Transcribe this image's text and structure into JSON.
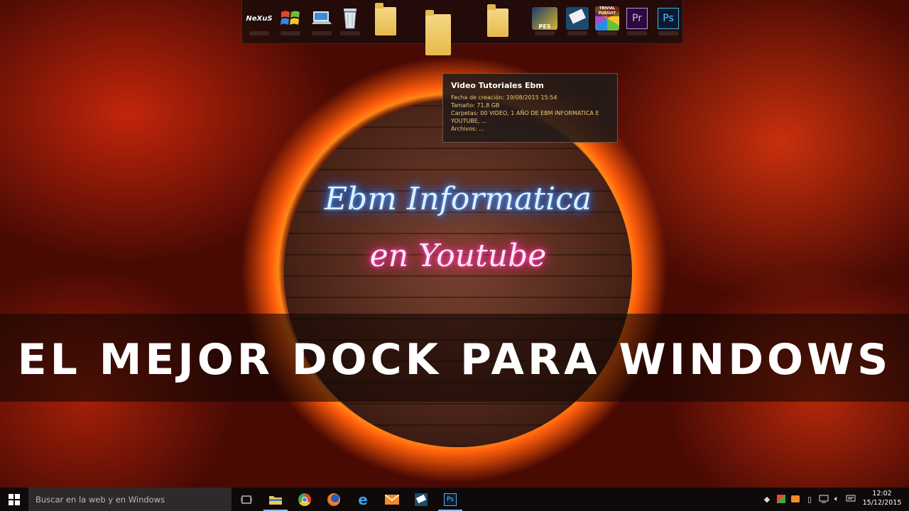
{
  "dock": {
    "items": [
      {
        "name": "nexus-icon",
        "label": "NeXuS"
      },
      {
        "name": "windows-icon",
        "label": ""
      },
      {
        "name": "computer-icon",
        "label": ""
      },
      {
        "name": "recycle-bin-icon",
        "label": ""
      },
      {
        "name": "folder-icon",
        "label": ""
      },
      {
        "name": "folder-icon",
        "label": ""
      },
      {
        "name": "folder-icon",
        "label": ""
      },
      {
        "name": "pes-icon",
        "label": "PES"
      },
      {
        "name": "app-icon",
        "label": ""
      },
      {
        "name": "trivial-pursuit-icon",
        "label": "TRIVIAL PURSUIT"
      },
      {
        "name": "premiere-icon",
        "label": "Pr"
      },
      {
        "name": "photoshop-icon",
        "label": "Ps"
      }
    ]
  },
  "tooltip": {
    "title": "Video Tutoriales Ebm",
    "creation": "Fecha de creación: 19/08/2015 15:54",
    "size": "Tamaño: 71,8 GB",
    "folders_line1": "Carpetas: 00 VIDEO, 1 AÑO DE EBM INFORMATICA E",
    "folders_line2": "YOUTUBE, ...",
    "files": "Archivos: ..."
  },
  "neon": {
    "line1": "Ebm Informatica",
    "line2": "en Youtube"
  },
  "headline": "EL MEJOR DOCK PARA WINDOWS",
  "taskbar": {
    "search_placeholder": "Buscar en la web y en Windows",
    "apps": [
      "task-view-icon",
      "file-explorer-icon",
      "chrome-icon",
      "firefox-icon",
      "edge-icon",
      "mail-icon",
      "app-icon",
      "photoshop-icon"
    ],
    "clock_time": "12:02",
    "clock_date": "15/12/2015",
    "colors": {
      "taskbar": "#0c0a0a",
      "search": "#2e2a2a"
    }
  }
}
